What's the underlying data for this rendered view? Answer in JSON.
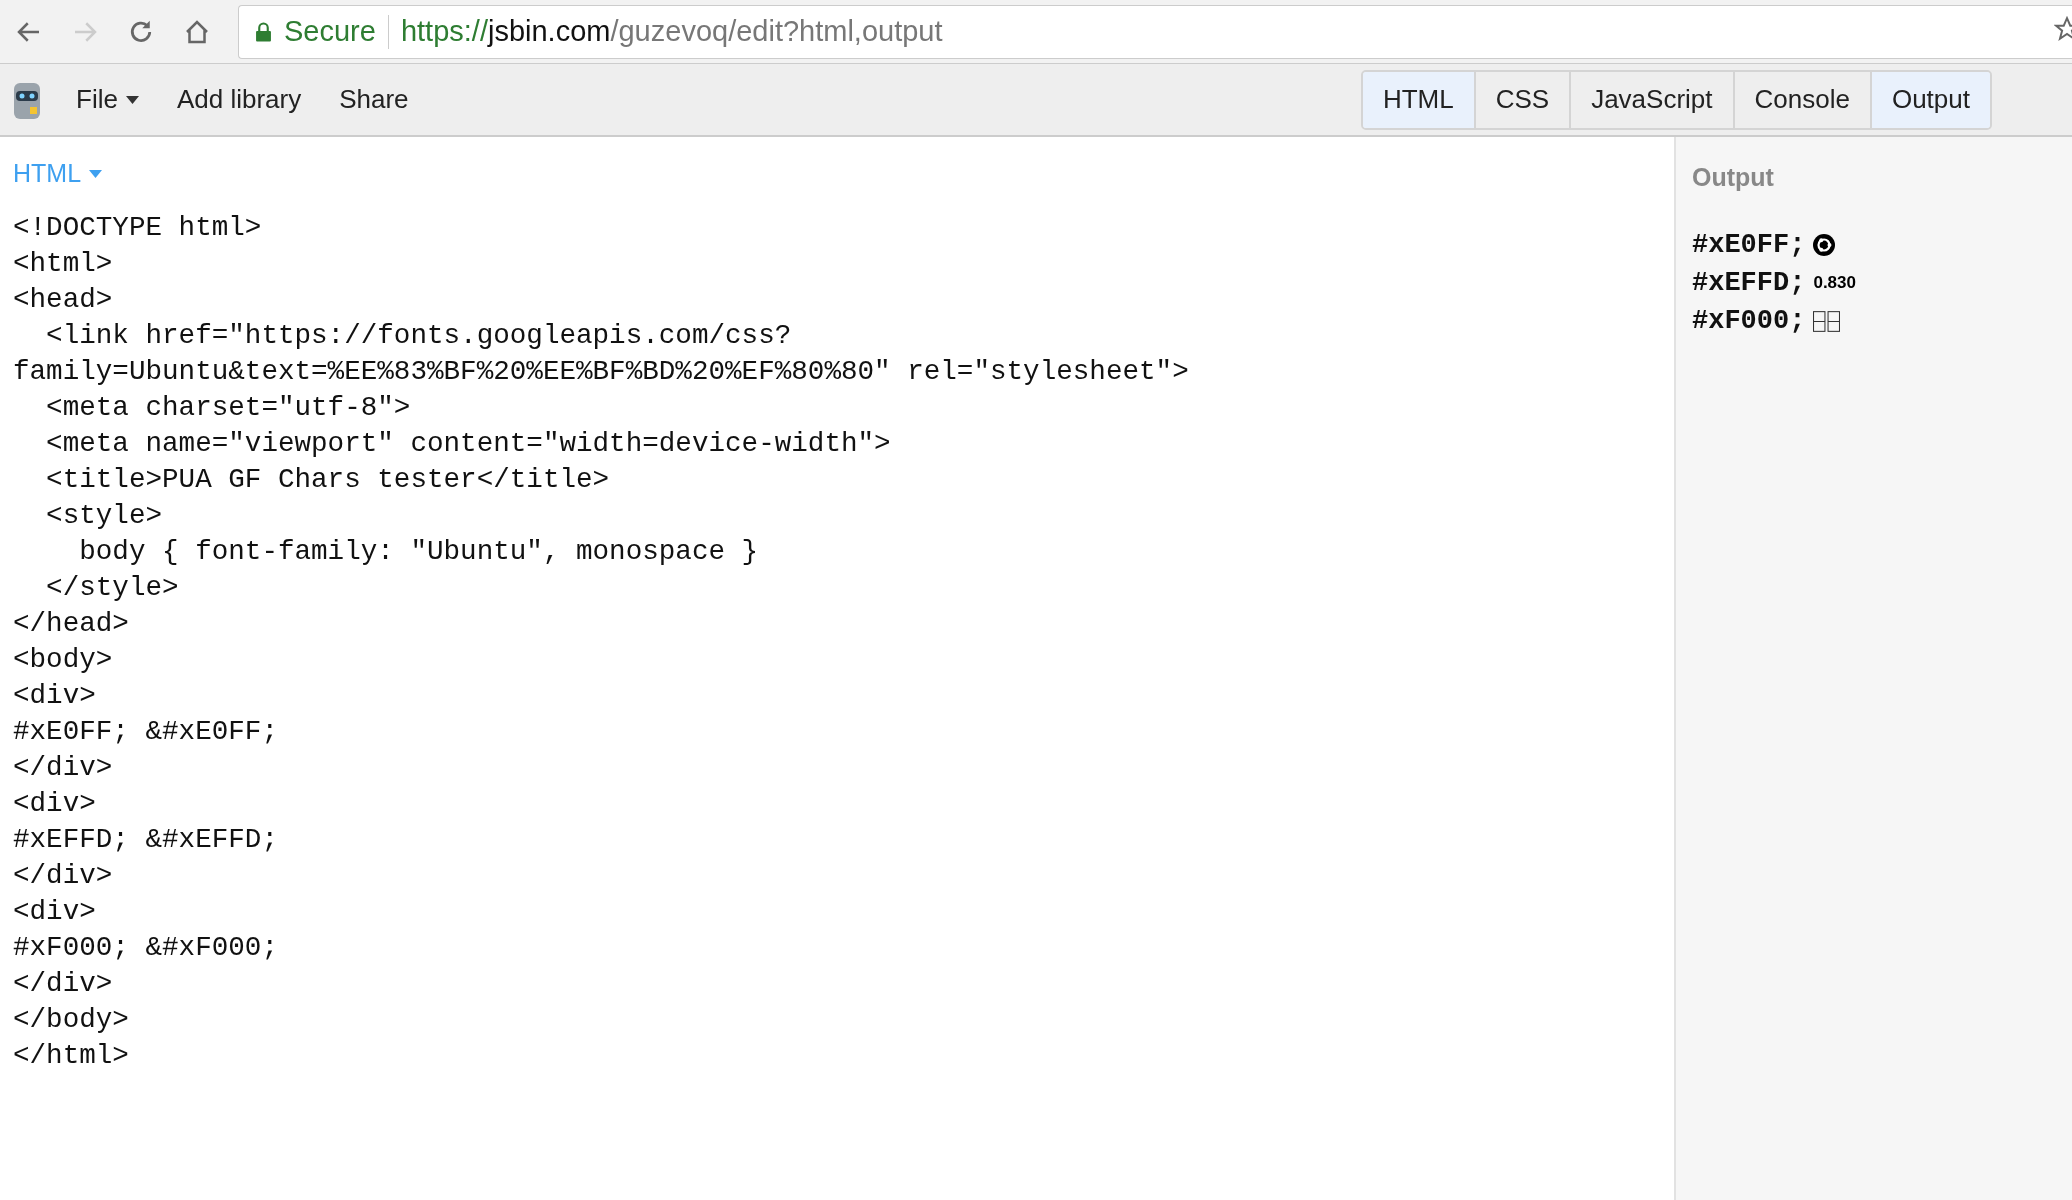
{
  "browser": {
    "secure_label": "Secure",
    "url_scheme": "https://",
    "url_host": "jsbin.com",
    "url_path": "/guzevoq/edit?html,output"
  },
  "toolbar": {
    "menus": [
      {
        "label": "File",
        "dropdown": true
      },
      {
        "label": "Add library",
        "dropdown": false
      },
      {
        "label": "Share",
        "dropdown": false
      }
    ],
    "tabs": [
      {
        "label": "HTML",
        "selected": true
      },
      {
        "label": "CSS",
        "selected": false
      },
      {
        "label": "JavaScript",
        "selected": false
      },
      {
        "label": "Console",
        "selected": false
      },
      {
        "label": "Output",
        "selected": true
      }
    ]
  },
  "editor": {
    "language": "HTML",
    "lines": [
      "<!DOCTYPE html>",
      "<html>",
      "<head>",
      "  <link href=\"https://fonts.googleapis.com/css?",
      "family=Ubuntu&text=%EE%83%BF%20%EE%BF%BD%20%EF%80%80\" rel=\"stylesheet\">",
      "  <meta charset=\"utf-8\">",
      "  <meta name=\"viewport\" content=\"width=device-width\">",
      "  <title>PUA GF Chars tester</title>",
      "  <style>",
      "    body { font-family: \"Ubuntu\", monospace }",
      "  </style>",
      "</head>",
      "<body>",
      "<div>",
      "#xE0FF; &#xE0FF;",
      "</div>",
      "<div>",
      "#xEFFD; &#xEFFD;",
      "</div>",
      "<div>",
      "#xF000; &#xF000;",
      "</div>",
      "</body>",
      "</html>"
    ]
  },
  "output": {
    "title": "Output",
    "rows": [
      {
        "code": "#xE0FF;",
        "kind": "logo"
      },
      {
        "code": "#xEFFD;",
        "kind": "text",
        "text": "0.830"
      },
      {
        "code": "#xF000;",
        "kind": "boxes"
      }
    ]
  }
}
